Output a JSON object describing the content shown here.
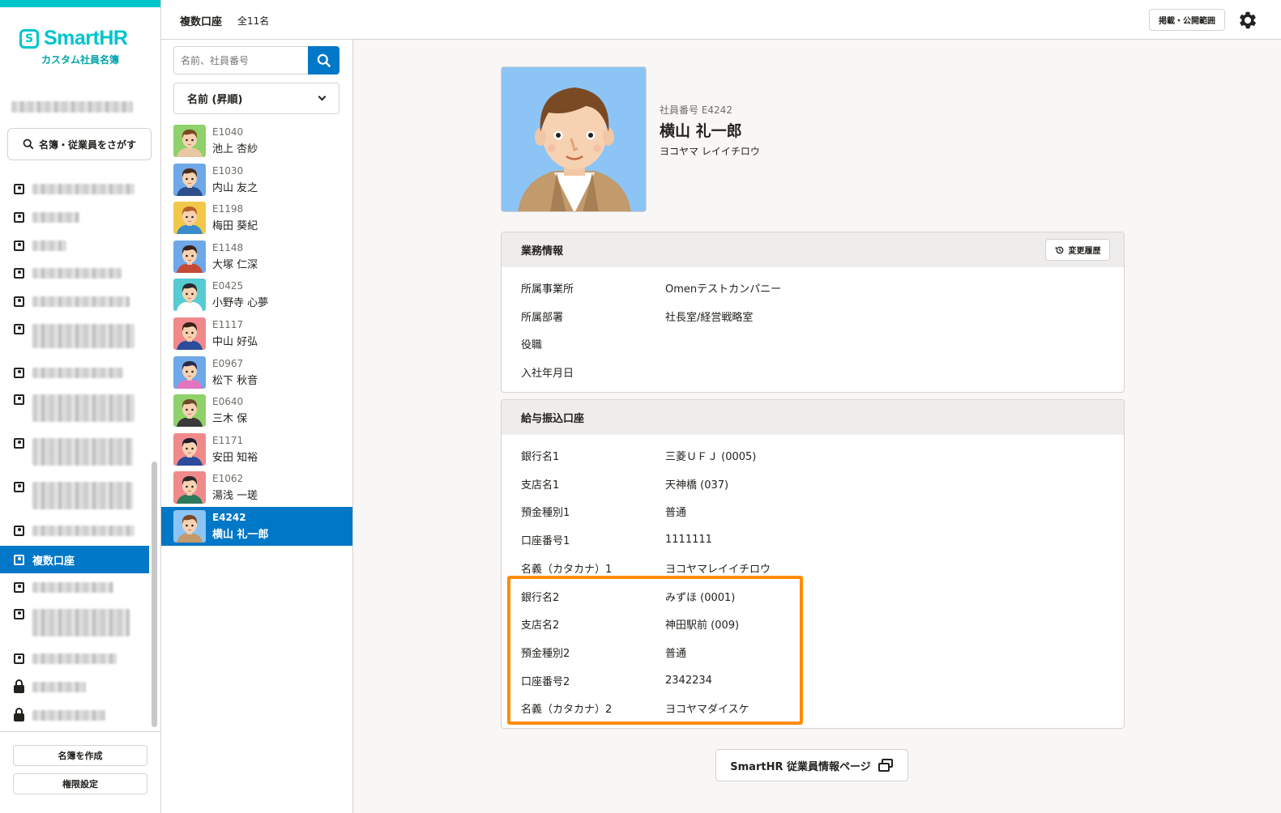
{
  "sidebar": {
    "logo": {
      "mark": "S",
      "name": "SmartHR",
      "subtitle": "カスタム社員名簿"
    },
    "search_label": "名簿・従業員をさがす",
    "active_item": "複数口座",
    "create_button": "名簿を作成",
    "permission_button": "権限設定"
  },
  "header": {
    "title": "複数口座",
    "count": "全11名",
    "scope_button": "掲載・公開範囲"
  },
  "list": {
    "search_placeholder": "名前、社員番号",
    "sort_label": "名前 (昇順)",
    "employees": [
      {
        "id": "E1040",
        "name": "池上 杏紗",
        "bg": "#8fd16a",
        "shirt": "#e9c7a2",
        "hair": "#7a4a24"
      },
      {
        "id": "E1030",
        "name": "内山 友之",
        "bg": "#6ea8e8",
        "shirt": "#2c4f8c",
        "hair": "#4b2d1c"
      },
      {
        "id": "E1198",
        "name": "梅田 葵紀",
        "bg": "#f2c84b",
        "shirt": "#3a8cc9",
        "hair": "#b8612a"
      },
      {
        "id": "E1148",
        "name": "大塚 仁深",
        "bg": "#6ea8e8",
        "shirt": "#c44a36",
        "hair": "#3b2217"
      },
      {
        "id": "E0425",
        "name": "小野寺 心夢",
        "bg": "#56cbd2",
        "shirt": "#ffffff",
        "hair": "#2a2a2a"
      },
      {
        "id": "E1117",
        "name": "中山 好弘",
        "bg": "#f08a8a",
        "shirt": "#2b4c9a",
        "hair": "#3b2217"
      },
      {
        "id": "E0967",
        "name": "松下 秋音",
        "bg": "#6ea8e8",
        "shirt": "#e074c0",
        "hair": "#2a2a4a"
      },
      {
        "id": "E0640",
        "name": "三木 保",
        "bg": "#8fd16a",
        "shirt": "#3a3a3a",
        "hair": "#6b4a2a"
      },
      {
        "id": "E1171",
        "name": "安田 知裕",
        "bg": "#f08a8a",
        "shirt": "#2b4c9a",
        "hair": "#1e1e2e"
      },
      {
        "id": "E1062",
        "name": "湯浅 一瑳",
        "bg": "#f08a8a",
        "shirt": "#2d7a5a",
        "hair": "#2a2a2a"
      },
      {
        "id": "E4242",
        "name": "横山 礼一郎",
        "bg": "#8cc4f5",
        "shirt": "#c29a6b",
        "hair": "#7a4a24"
      }
    ]
  },
  "profile": {
    "emp_no_label": "社員番号 E4242",
    "name": "横山 礼一郎",
    "kana": "ヨコヤマ レイイチロウ"
  },
  "work_panel": {
    "title": "業務情報",
    "history_button": "変更履歴",
    "rows": [
      {
        "k": "所属事業所",
        "v": "Omenテストカンパニー"
      },
      {
        "k": "所属部署",
        "v": "社長室/経営戦略室"
      },
      {
        "k": "役職",
        "v": ""
      },
      {
        "k": "入社年月日",
        "v": ""
      }
    ]
  },
  "bank_panel": {
    "title": "給与振込口座",
    "rows": [
      {
        "k": "銀行名1",
        "v": "三菱ＵＦＪ (0005)"
      },
      {
        "k": "支店名1",
        "v": "天神橋 (037)"
      },
      {
        "k": "預金種別1",
        "v": "普通"
      },
      {
        "k": "口座番号1",
        "v": "1111111"
      },
      {
        "k": "名義（カタカナ）1",
        "v": "ヨコヤマレイイチロウ"
      },
      {
        "k": "銀行名2",
        "v": "みずほ (0001)"
      },
      {
        "k": "支店名2",
        "v": "神田駅前 (009)"
      },
      {
        "k": "預金種別2",
        "v": "普通"
      },
      {
        "k": "口座番号2",
        "v": "2342234"
      },
      {
        "k": "名義（カタカナ）2",
        "v": "ヨコヤマダイスケ"
      }
    ]
  },
  "footer_button": "SmartHR 従業員情報ページ",
  "colors": {
    "accent": "#0077c7",
    "brand": "#00c4cc",
    "highlight": "#ff8c00"
  }
}
